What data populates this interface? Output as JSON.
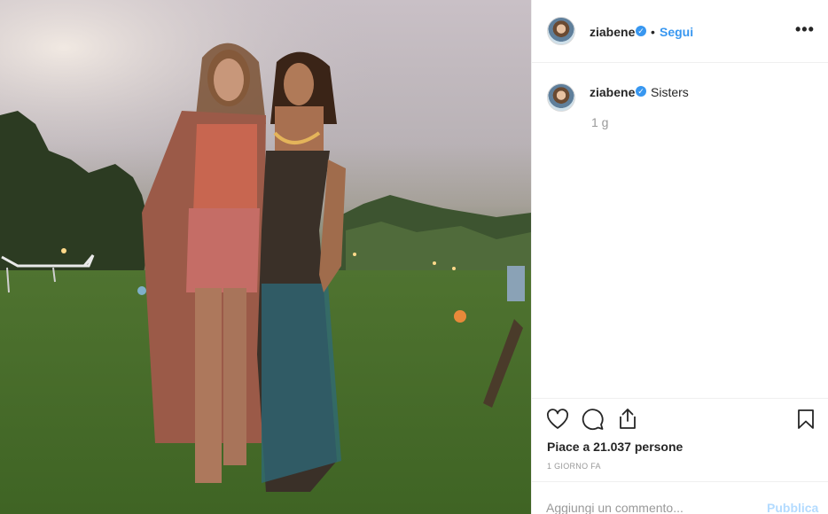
{
  "post": {
    "image_alt": "Two women standing on a lawn at dusk"
  },
  "header": {
    "username": "ziabene",
    "separator": "•",
    "follow_label": "Segui",
    "more_label": "•••"
  },
  "caption": {
    "username": "ziabene",
    "text": "Sisters",
    "time": "1 g"
  },
  "actions": {
    "like_icon": "heart-icon",
    "comment_icon": "comment-icon",
    "share_icon": "share-icon",
    "save_icon": "bookmark-icon"
  },
  "likes": "Piace a 21.037 persone",
  "date": "1 GIORNO FA",
  "comment_box": {
    "placeholder": "Aggiungi un commento...",
    "publish_label": "Pubblica"
  },
  "colors": {
    "accent": "#3897f0",
    "verified": "#3897f0",
    "muted": "#999999",
    "publish_disabled": "#b3dbff"
  }
}
